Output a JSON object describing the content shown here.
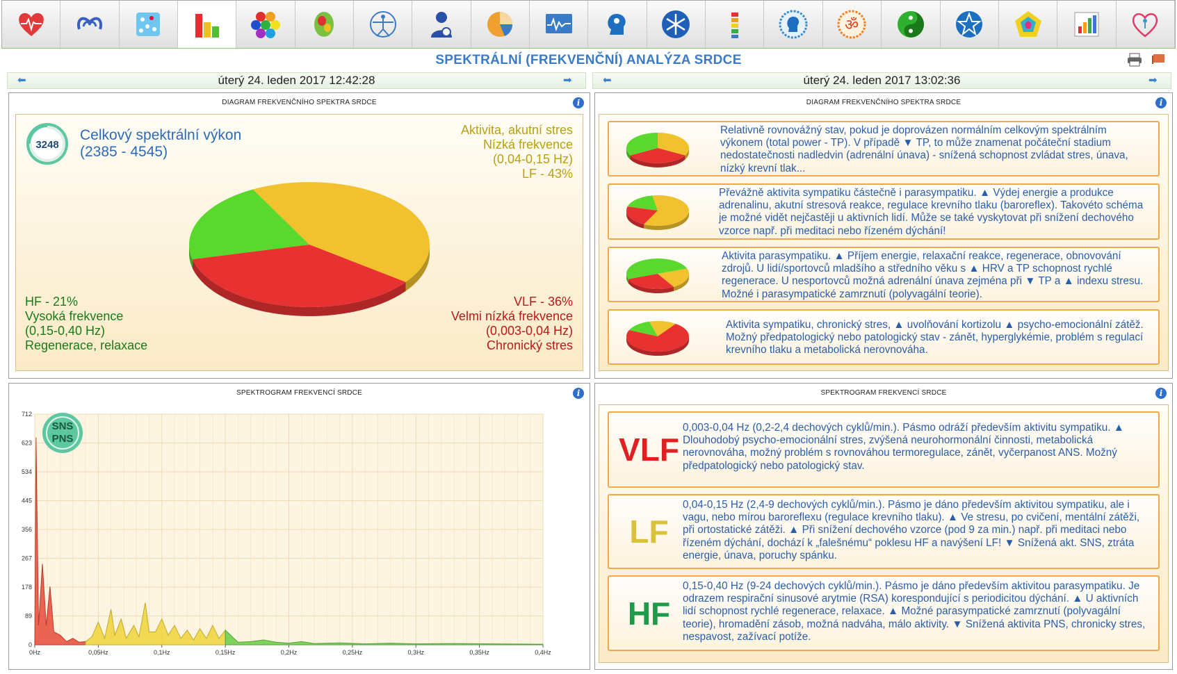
{
  "toolbar": {
    "icons": [
      "heart-icon",
      "hands-heart-icon",
      "cells-icon",
      "bar-chart-icon",
      "hexagons-icon",
      "brain-map-icon",
      "vitruvian-man-icon",
      "person-icon",
      "pie-icon",
      "monitor-wave-icon",
      "head-icon",
      "snowflake-icon",
      "spine-icon",
      "profile-circle-icon",
      "om-icon",
      "yin-yang-icon",
      "star-circle-icon",
      "pentagon-icon",
      "bar-chart-small-icon",
      "heart-person-icon"
    ],
    "active_index": 3
  },
  "title": "SPEKTRÁLNÍ (FREKVENČNÍ) ANALÝZA SRDCE",
  "left_date": "úterý 24. leden 2017 12:42:28",
  "right_date": "úterý 24. leden 2017 13:02:36",
  "top_left": {
    "title": "DIAGRAM FREKVENČNÍHO SPEKTRA SRDCE",
    "badge_value": "3248",
    "total_power_label": "Celkový spektrální výkon",
    "total_power_range": "(2385 - 4545)",
    "lf": {
      "line1": "Aktivita, akutní stres",
      "line2": "Nízká frekvence",
      "line3": "(0,04-0,15 Hz)",
      "line4": "LF - 43%"
    },
    "hf": {
      "line1": "HF - 21%",
      "line2": "Vysoká frekvence",
      "line3": "(0,15-0,40 Hz)",
      "line4": "Regenerace, relaxace"
    },
    "vlf": {
      "line1": "VLF - 36%",
      "line2": "Velmi nízká frekvence",
      "line3": "(0,003-0,04 Hz)",
      "line4": "Chronický stres"
    },
    "pie": {
      "lf": 43,
      "vlf": 36,
      "hf": 21
    },
    "colors": {
      "lf": "#f2c22e",
      "vlf": "#e83232",
      "hf": "#5ad82e"
    }
  },
  "top_right": {
    "title": "DIAGRAM FREKVENČNÍHO SPEKTRA SRDCE",
    "cards": [
      {
        "text": "Relativně rovnovážný stav, pokud je doprovázen normálním celkovým spektrálním výkonem (total power - TP). V případě ▼ TP, to může znamenat počáteční stadium nedostatečnosti nadledvin (adrenální únava) - snížená schopnost zvládat stres, únava, nízký krevní tlak..."
      },
      {
        "text": "Převážně aktivita sympatiku částečně i parasympatiku. ▲ Výdej energie a produkce adrenalinu, akutní stresová reakce, regulace krevního tlaku (baroreflex). Takovéto schéma je možné vidět nejčastěji u aktivních lidí. Může se také vyskytovat při snížení dechového vzorce např. při meditaci nebo řízeném dýchání!"
      },
      {
        "text": "Aktivita parasympatiku. ▲ Příjem energie, relaxační reakce, regenerace, obnovování zdrojů. U lidí/sportovců mladšího a středního věku s ▲ HRV a TP schopnost rychlé regenerace. U nesportovců možná adrenální únava zejména při ▼ TP a ▲ indexu stresu. Možné i parasympatické zamrznutí (polyvagální teorie)."
      },
      {
        "text": "Aktivita sympatiku, chronický stres, ▲ uvolňování kortizolu ▲ psycho-emocionální zátěž. Možný předpatologický nebo patologický stav - zánět, hyperglykémie, problém s regulací krevního tlaku a metabolická nerovnováha."
      }
    ]
  },
  "bottom_left": {
    "title": "SPEKTROGRAM FREKVENCÍ SRDCE",
    "badge_line1": "SNS",
    "badge_line2": "PNS",
    "chart_data": {
      "type": "area",
      "y_ticks": [
        "712",
        "623",
        "534",
        "445",
        "356",
        "267",
        "178",
        "89",
        "0"
      ],
      "x_ticks": [
        "0Hz",
        "0,05Hz",
        "0,1Hz",
        "0,15Hz",
        "0,2Hz",
        "0,25Hz",
        "0,3Hz",
        "0,35Hz",
        "0,4Hz"
      ],
      "ylim": [
        0,
        712
      ],
      "xlim": [
        0,
        0.4
      ],
      "bands": [
        {
          "name": "VLF",
          "color": "#e84a3a",
          "points": [
            [
              0.0,
              0
            ],
            [
              0.001,
              640
            ],
            [
              0.003,
              60
            ],
            [
              0.006,
              250
            ],
            [
              0.009,
              60
            ],
            [
              0.012,
              180
            ],
            [
              0.015,
              40
            ],
            [
              0.02,
              30
            ],
            [
              0.025,
              10
            ],
            [
              0.03,
              20
            ],
            [
              0.035,
              8
            ],
            [
              0.04,
              10
            ]
          ]
        },
        {
          "name": "LF",
          "color": "#f0d43a",
          "points": [
            [
              0.04,
              10
            ],
            [
              0.045,
              25
            ],
            [
              0.05,
              70
            ],
            [
              0.055,
              20
            ],
            [
              0.06,
              110
            ],
            [
              0.063,
              30
            ],
            [
              0.068,
              80
            ],
            [
              0.072,
              20
            ],
            [
              0.078,
              60
            ],
            [
              0.082,
              25
            ],
            [
              0.087,
              130
            ],
            [
              0.09,
              40
            ],
            [
              0.095,
              40
            ],
            [
              0.1,
              80
            ],
            [
              0.105,
              30
            ],
            [
              0.11,
              60
            ],
            [
              0.115,
              20
            ],
            [
              0.12,
              45
            ],
            [
              0.125,
              15
            ],
            [
              0.13,
              50
            ],
            [
              0.135,
              20
            ],
            [
              0.14,
              60
            ],
            [
              0.145,
              20
            ],
            [
              0.15,
              45
            ]
          ]
        },
        {
          "name": "HF",
          "color": "#66cc44",
          "points": [
            [
              0.15,
              45
            ],
            [
              0.16,
              8
            ],
            [
              0.17,
              10
            ],
            [
              0.18,
              15
            ],
            [
              0.19,
              8
            ],
            [
              0.2,
              5
            ],
            [
              0.21,
              10
            ],
            [
              0.22,
              4
            ],
            [
              0.24,
              6
            ],
            [
              0.26,
              3
            ],
            [
              0.28,
              5
            ],
            [
              0.3,
              3
            ],
            [
              0.33,
              4
            ],
            [
              0.36,
              3
            ],
            [
              0.4,
              2
            ]
          ]
        }
      ]
    }
  },
  "bottom_right": {
    "title": "SPEKTROGRAM FREKVENCÍ SRDCE",
    "cards": [
      {
        "label": "VLF",
        "color": "#e02020",
        "text": "0,003-0,04 Hz (0,2-2,4 dechových cyklů/min.). Pásmo odráží především aktivitu sympatiku. ▲ Dlouhodobý psycho-emocionální stres, zvýšená neurohormonální činnosti, metabolická nerovnováha, možný problém s rovnováhou termoregulace, zánět, vyčerpanost ANS. Možný předpatologický nebo patologický stav."
      },
      {
        "label": "LF",
        "color": "#d9c23a",
        "text": "0,04-0,15 Hz (2,4-9 dechových cyklů/min.). Pásmo je dáno především aktivitou sympatiku, ale i vagu, nebo mírou baroreflexu (regulace krevního tlaku). ▲ Ve stresu, po cvičení, mentální zátěži, při ortostatické zátěži. ▲ Při snížení dechového vzorce (pod 9 za min.) např. při meditaci nebo řízeném dýchání, dochází k „falešnému“ poklesu HF a navýšení LF! ▼ Snížená akt. SNS, ztráta energie, únava, poruchy spánku."
      },
      {
        "label": "HF",
        "color": "#1f9a4a",
        "text": "0,15-0,40 Hz (9-24 dechových cyklů/min.). Pásmo je dáno především aktivitou parasympatiku. Je odrazem respirační sinusové arytmie (RSA) korespondující s periodicitou dýchání. ▲ U aktivních lidí schopnost rychlé regenerace, relaxace. ▲ Možné parasympatické zamrznutí (polyvagální teorie), hromadění zásob, možná nadváha, málo aktivity. ▼ Snížená aktivita PNS, chronicky stres, nespavost, zažívací potíže."
      }
    ]
  }
}
